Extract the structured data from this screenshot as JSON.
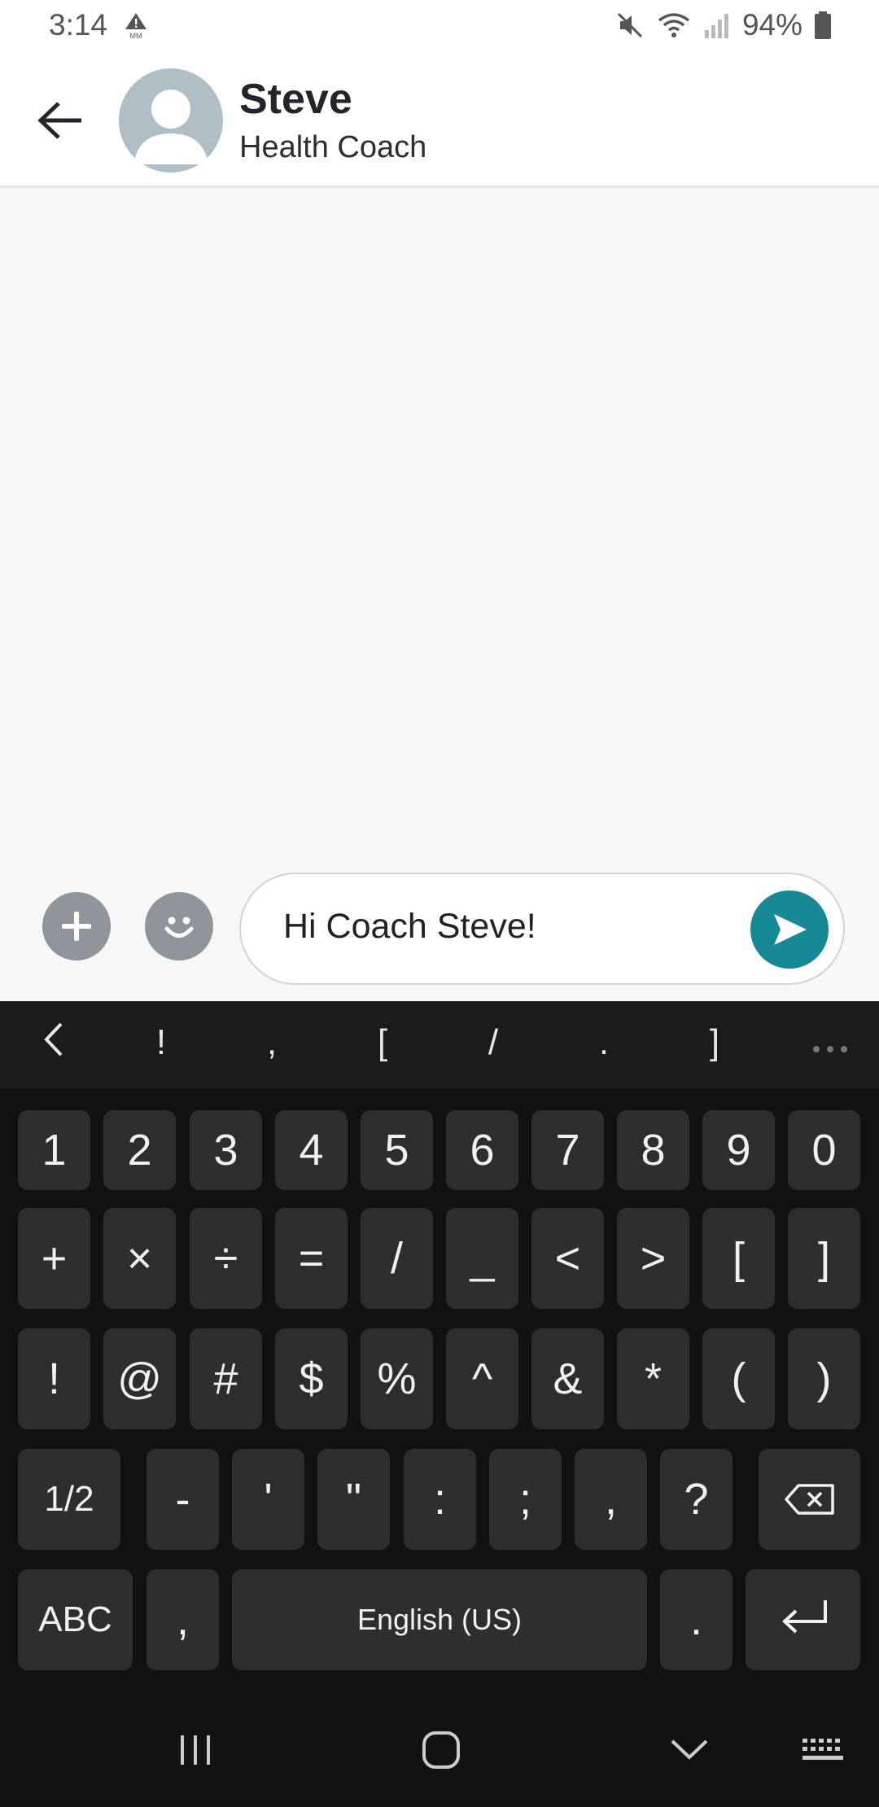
{
  "status_bar": {
    "time": "3:14",
    "alert_label": "MM",
    "battery": "94%"
  },
  "header": {
    "contact_name": "Steve",
    "contact_role": "Health Coach"
  },
  "composer": {
    "message_text": "Hi Coach Steve!",
    "accent_color": "#168896"
  },
  "keyboard": {
    "suggestions": [
      "!",
      ",",
      "[",
      "/",
      ".",
      "]"
    ],
    "rows": [
      [
        "1",
        "2",
        "3",
        "4",
        "5",
        "6",
        "7",
        "8",
        "9",
        "0"
      ],
      [
        "+",
        "×",
        "÷",
        "=",
        "/",
        "_",
        "<",
        ">",
        "[",
        "]"
      ],
      [
        "!",
        "@",
        "#",
        "$",
        "%",
        "^",
        "&",
        "*",
        "(",
        ")"
      ],
      [
        "1/2",
        "-",
        "'",
        "\"",
        ":",
        ";",
        ",",
        "?"
      ],
      [
        "ABC",
        ",",
        "English (US)",
        "."
      ]
    ]
  },
  "nav": {
    "icons": [
      "recent-apps-icon",
      "home-icon",
      "back-down-icon",
      "keyboard-icon"
    ]
  }
}
